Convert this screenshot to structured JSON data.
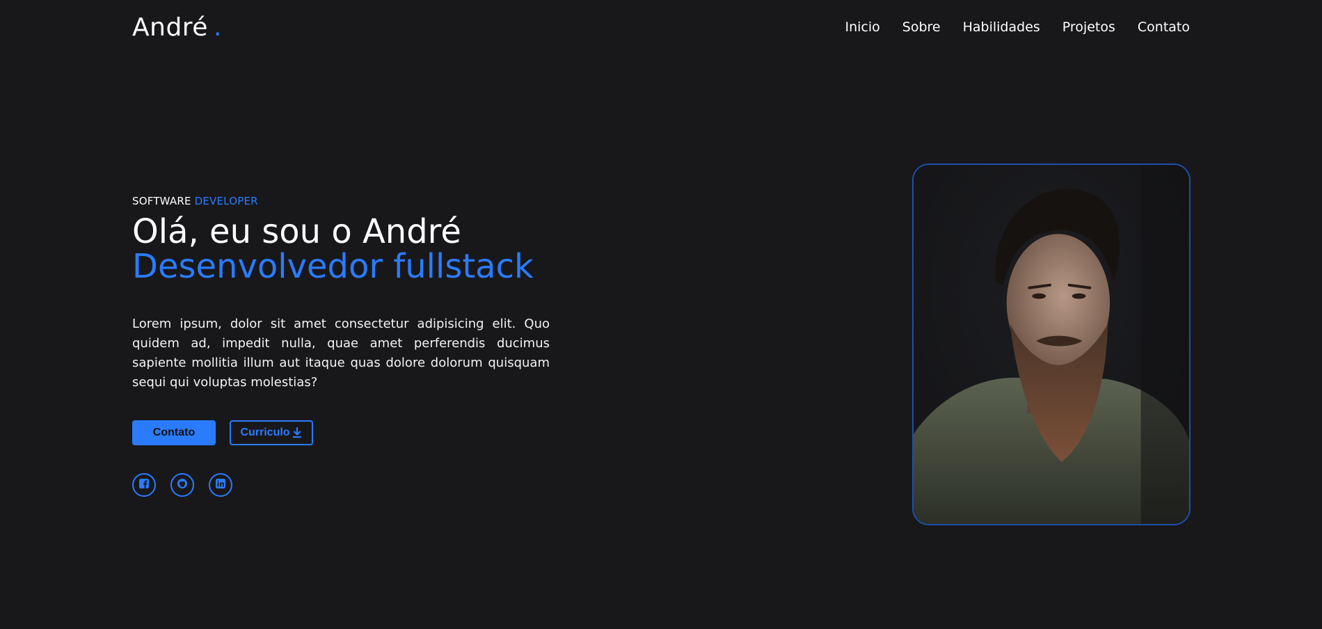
{
  "header": {
    "logo_text": "André",
    "logo_dot": ".",
    "nav": [
      "Inicio",
      "Sobre",
      "Habilidades",
      "Projetos",
      "Contato"
    ]
  },
  "hero": {
    "tag_primary": "SOFTWARE",
    "tag_accent": "DEVELOPER",
    "headline": "Olá, eu sou o André",
    "role": "Desenvolvedor fullstack",
    "description": "Lorem ipsum, dolor sit amet consectetur adipisicing elit. Quo quidem ad, impedit nulla, quae amet perferendis ducimus sapiente mollitia illum aut itaque quas dolore dolorum quisquam sequi qui voluptas molestias?",
    "btn_contact": "Contato",
    "btn_cv": "Curriculo"
  },
  "socials": [
    {
      "icon": "facebook-icon"
    },
    {
      "icon": "github-icon"
    },
    {
      "icon": "linkedin-icon"
    }
  ],
  "colors": {
    "background": "#18181b",
    "accent": "#2b7bff",
    "text": "#ffffff"
  }
}
